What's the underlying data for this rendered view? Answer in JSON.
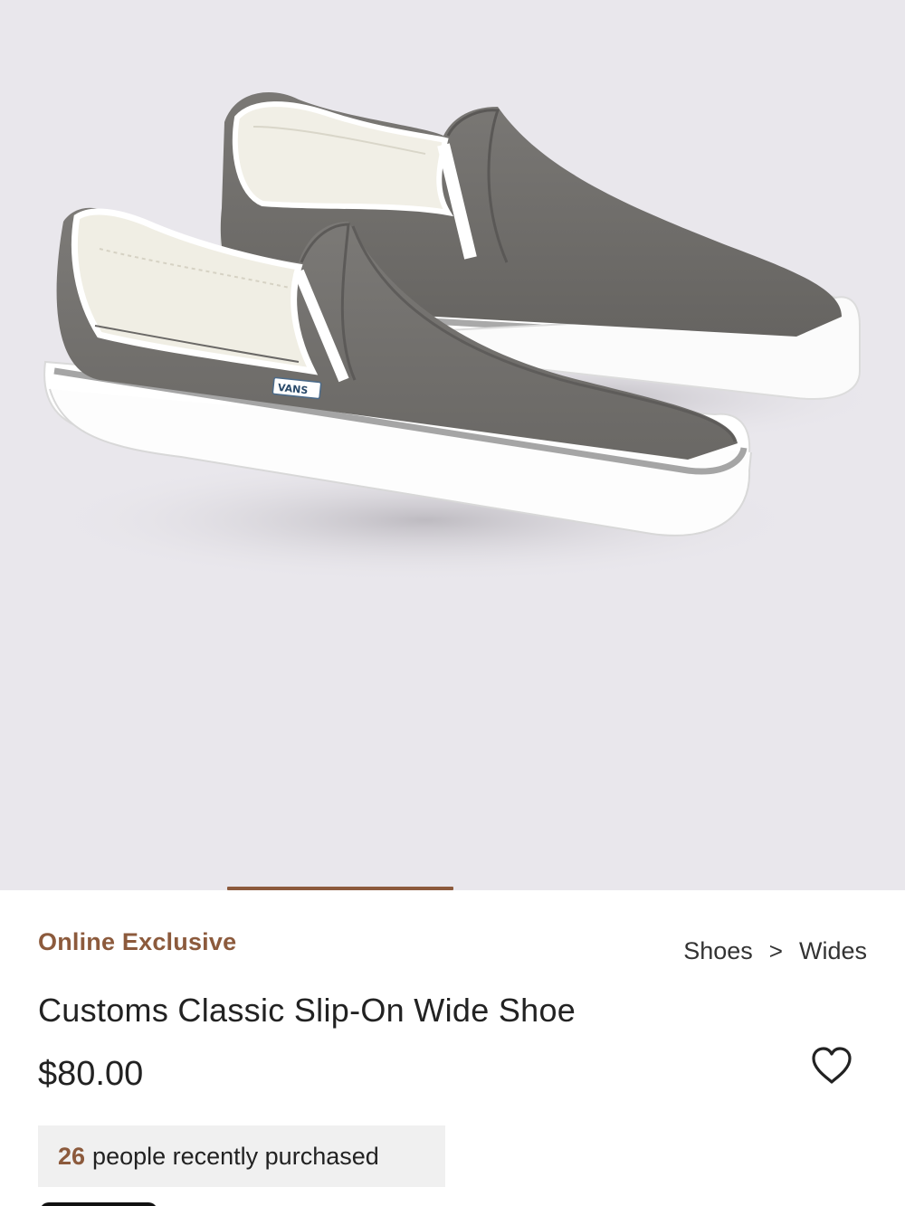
{
  "gallery": {
    "image_alt": "Customs Classic Slip-On Wide Shoe",
    "background_color": "#e9e7ec",
    "shoe_color": "#6e6c6a",
    "shoe_logo_text": "VANS",
    "active_slide_indicator_color": "#8c5a3c"
  },
  "product": {
    "badge": "Online Exclusive",
    "title": "Customs Classic Slip-On Wide Shoe",
    "price": "$80.00"
  },
  "breadcrumb": {
    "items": [
      "Shoes",
      "Wides"
    ],
    "separator": ">"
  },
  "wishlist": {
    "icon": "heart-outline-icon"
  },
  "social_proof": {
    "count": "26",
    "text": "people recently purchased"
  },
  "colors": {
    "accent": "#8c5a3c",
    "text": "#222222",
    "chip_background": "#f0f0f0"
  }
}
